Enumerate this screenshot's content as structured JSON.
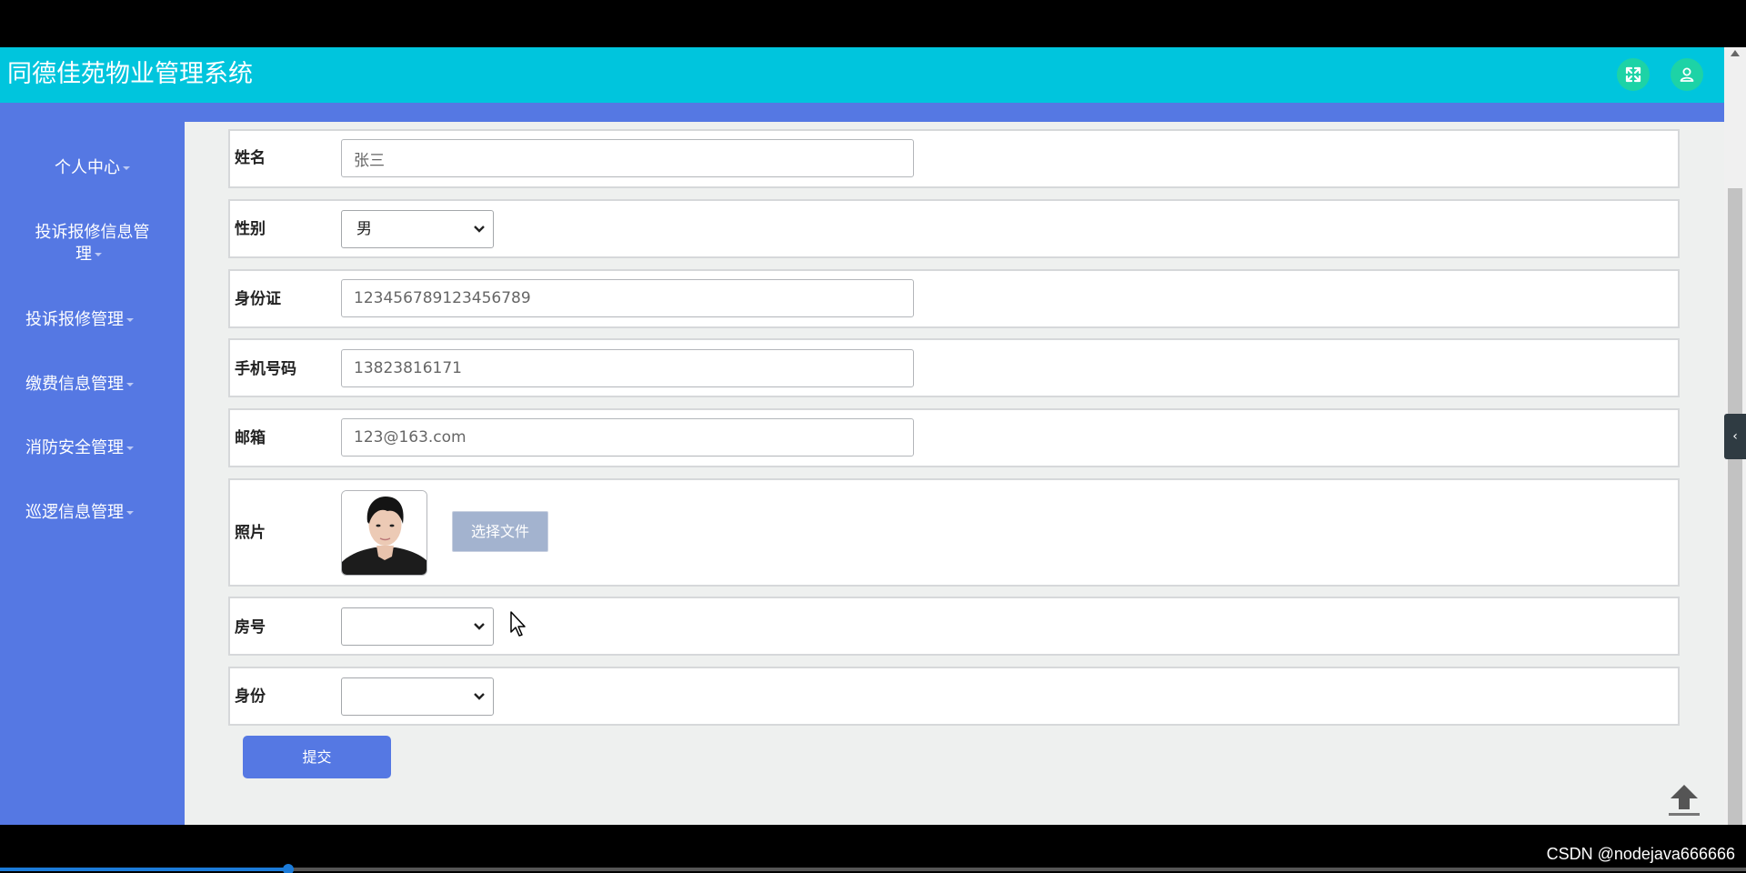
{
  "header": {
    "title": "同德佳苑物业管理系统",
    "icons": [
      "expand-icon",
      "user-icon"
    ]
  },
  "sidebar": {
    "items": [
      {
        "label": "个人中心"
      },
      {
        "label": "投诉报修信息管",
        "label_line2": "理"
      },
      {
        "label": "投诉报修管理"
      },
      {
        "label": "缴费信息管理"
      },
      {
        "label": "消防安全管理"
      },
      {
        "label": "巡逻信息管理"
      }
    ]
  },
  "form": {
    "name": {
      "label": "姓名",
      "value": "张三"
    },
    "gender": {
      "label": "性别",
      "value": "男"
    },
    "id_card": {
      "label": "身份证",
      "value": "123456789123456789"
    },
    "phone": {
      "label": "手机号码",
      "value": "13823816171"
    },
    "email": {
      "label": "邮箱",
      "value": "123@163.com"
    },
    "photo": {
      "label": "照片",
      "button": "选择文件"
    },
    "room": {
      "label": "房号",
      "value": ""
    },
    "identity": {
      "label": "身份",
      "value": ""
    },
    "submit": "提交"
  },
  "player": {
    "progress": 0.165,
    "watermark": "CSDN @nodejava666666"
  },
  "colors": {
    "header": "#00c5dd",
    "sidebar": "#5578e3",
    "header_button": "#1dd3a6"
  }
}
